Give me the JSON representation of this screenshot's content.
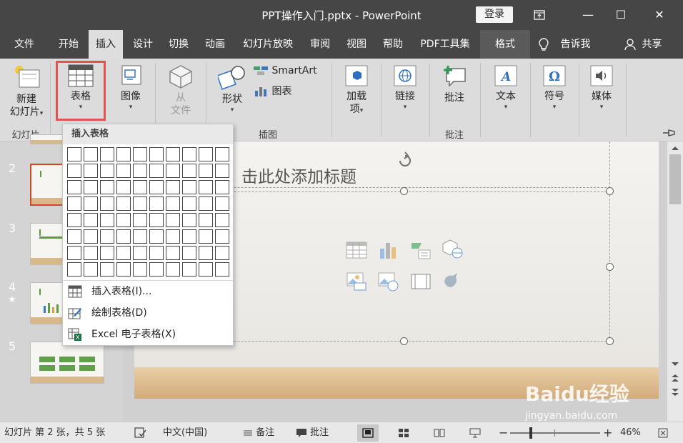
{
  "window": {
    "title": "PPT操作入门.pptx  -  PowerPoint",
    "login": "登录",
    "restore_icon": "ribbon-display-icon",
    "minimize": "—",
    "maximize": "☐",
    "close": "✕"
  },
  "tabs": [
    "文件",
    "开始",
    "插入",
    "设计",
    "切换",
    "动画",
    "幻灯片放映",
    "审阅",
    "视图",
    "帮助",
    "PDF工具集",
    "格式"
  ],
  "active_tab": "插入",
  "tell_me": "告诉我",
  "share": "共享",
  "ribbon": {
    "new_slide": [
      "新建",
      "幻灯片"
    ],
    "table": "表格",
    "image": "图像",
    "from_file": [
      "从",
      "文件"
    ],
    "shapes": "形状",
    "smartart": "SmartArt",
    "chart": "图表",
    "addins": [
      "加载",
      "项"
    ],
    "links": "链接",
    "comment": "批注",
    "text": "文本",
    "symbols": "符号",
    "media": "媒体",
    "groups": {
      "slides": "幻灯片",
      "illustrations": "插图",
      "comments": "批注"
    }
  },
  "dropdown": {
    "header": "插入表格",
    "grid_cols": 10,
    "grid_rows": 8,
    "items": [
      {
        "label": "插入表格(I)...",
        "icon": "table-icon"
      },
      {
        "label": "绘制表格(D)",
        "icon": "draw-table-icon"
      },
      {
        "label": "Excel 电子表格(X)",
        "icon": "excel-icon"
      }
    ]
  },
  "thumbnails": [
    "2",
    "3",
    "4",
    "5"
  ],
  "thumb_star": "★",
  "slide": {
    "title_fragment": "击此处添加标题"
  },
  "statusbar": {
    "slide_info": "幻灯片 第 2 张，共 5 张",
    "language": "中文(中国)",
    "notes": "备注",
    "comments": "批注",
    "zoom_minus": "−",
    "zoom_plus": "+",
    "zoom": "46%",
    "zoom_level": 0.46
  },
  "watermark": {
    "brand": "Baidu经验",
    "url": "jingyan.baidu.com"
  },
  "colors": {
    "titlebar": "#464646",
    "highlight": "#e05550",
    "selected_thumb": "#d24726"
  }
}
